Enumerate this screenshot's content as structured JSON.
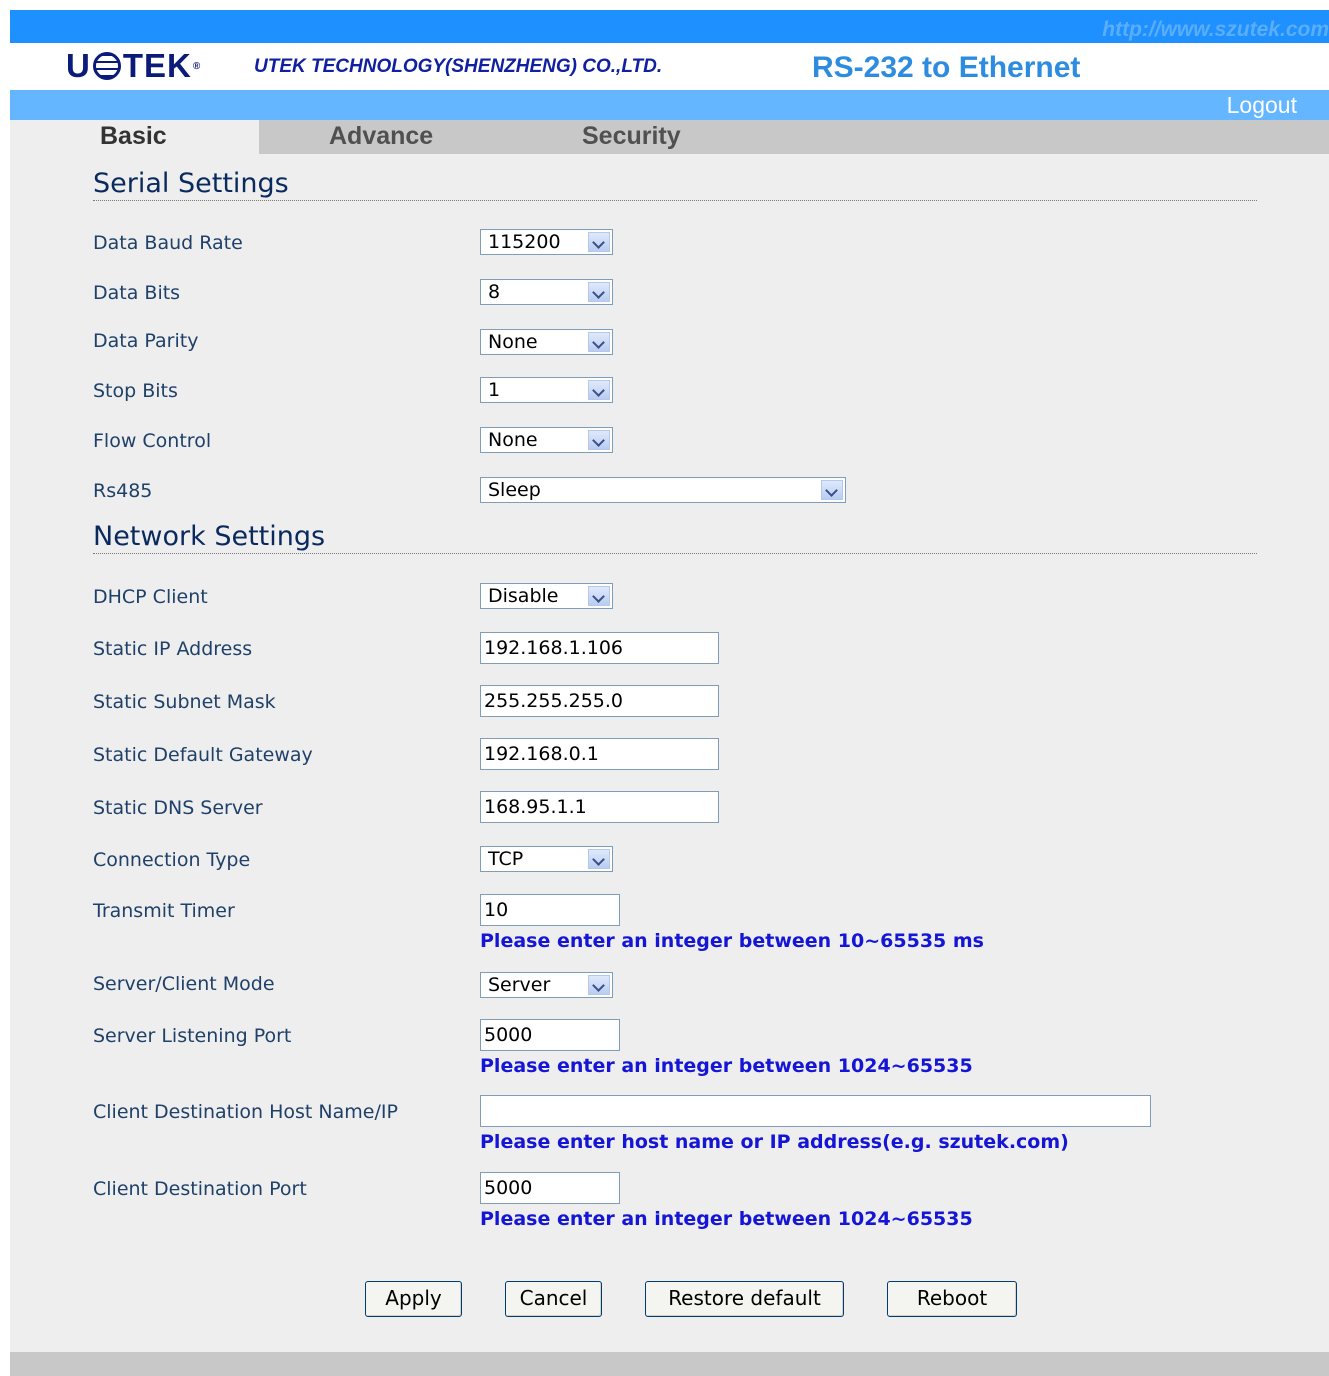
{
  "header": {
    "url": "http://www.szutek.com",
    "logo_left": "U",
    "logo_right": "TEK",
    "logo_mark": "®",
    "company": "UTEK TECHNOLOGY(SHENZHENG) CO.,LTD.",
    "product": "RS-232 to Ethernet",
    "logout": "Logout"
  },
  "tabs": [
    "Basic",
    "Advance",
    "Security"
  ],
  "serial": {
    "title": "Serial Settings",
    "baud_label": "Data Baud Rate",
    "baud_value": "115200",
    "bits_label": "Data Bits",
    "bits_value": "8",
    "parity_label": "Data Parity",
    "parity_value": "None",
    "stop_label": "Stop Bits",
    "stop_value": "1",
    "flow_label": "Flow Control",
    "flow_value": "None",
    "rs485_label": "Rs485",
    "rs485_value": "Sleep"
  },
  "network": {
    "title": "Network Settings",
    "dhcp_label": "DHCP Client",
    "dhcp_value": "Disable",
    "ip_label": "Static IP Address",
    "ip_value": "192.168.1.106",
    "mask_label": "Static Subnet Mask",
    "mask_value": "255.255.255.0",
    "gateway_label": "Static Default Gateway",
    "gateway_value": "192.168.0.1",
    "dns_label": "Static DNS Server",
    "dns_value": "168.95.1.1",
    "conn_label": "Connection Type",
    "conn_value": "TCP",
    "timer_label": "Transmit Timer",
    "timer_value": "10",
    "timer_hint": "Please enter an integer between 10~65535 ms",
    "mode_label": "Server/Client Mode",
    "mode_value": "Server",
    "listen_label": "Server Listening Port",
    "listen_value": "5000",
    "listen_hint": "Please enter an integer between 1024~65535",
    "host_label": "Client Destination Host Name/IP",
    "host_value": "",
    "host_hint": "Please enter host name or IP address(e.g. szutek.com)",
    "dport_label": "Client Destination Port",
    "dport_value": "5000",
    "dport_hint": "Please enter an integer between 1024~65535"
  },
  "buttons": {
    "apply": "Apply",
    "cancel": "Cancel",
    "restore": "Restore default",
    "reboot": "Reboot"
  }
}
